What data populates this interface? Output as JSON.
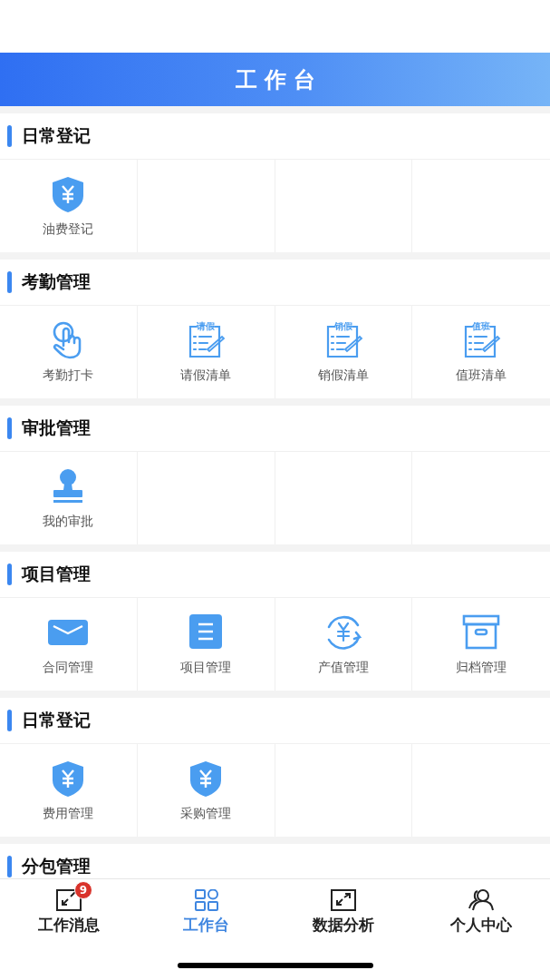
{
  "header": {
    "title": "工作台"
  },
  "sections": [
    {
      "title": "日常登记",
      "items": [
        {
          "label": "油费登记",
          "kind": "shield-yen"
        }
      ]
    },
    {
      "title": "考勤管理",
      "items": [
        {
          "label": "考勤打卡",
          "kind": "hand"
        },
        {
          "label": "请假清单",
          "kind": "form",
          "icon_text": "请假"
        },
        {
          "label": "销假清单",
          "kind": "form",
          "icon_text": "销假"
        },
        {
          "label": "值班清单",
          "kind": "form",
          "icon_text": "值班"
        }
      ]
    },
    {
      "title": "审批管理",
      "items": [
        {
          "label": "我的审批",
          "kind": "stamp"
        }
      ]
    },
    {
      "title": "项目管理",
      "items": [
        {
          "label": "合同管理",
          "kind": "mail"
        },
        {
          "label": "项目管理",
          "kind": "list"
        },
        {
          "label": "产值管理",
          "kind": "yen-cycle"
        },
        {
          "label": "归档管理",
          "kind": "box"
        }
      ]
    },
    {
      "title": "日常登记",
      "items": [
        {
          "label": "费用管理",
          "kind": "shield-yen"
        },
        {
          "label": "采购管理",
          "kind": "shield-yen"
        }
      ]
    },
    {
      "title": "分包管理"
    }
  ],
  "tab_bar": [
    {
      "label": "工作消息",
      "kind": "collapse",
      "selected": false,
      "badge": "9"
    },
    {
      "label": "工作台",
      "kind": "grid",
      "selected": true
    },
    {
      "label": "数据分析",
      "kind": "expand",
      "selected": false
    },
    {
      "label": "个人中心",
      "kind": "people",
      "selected": false
    }
  ]
}
